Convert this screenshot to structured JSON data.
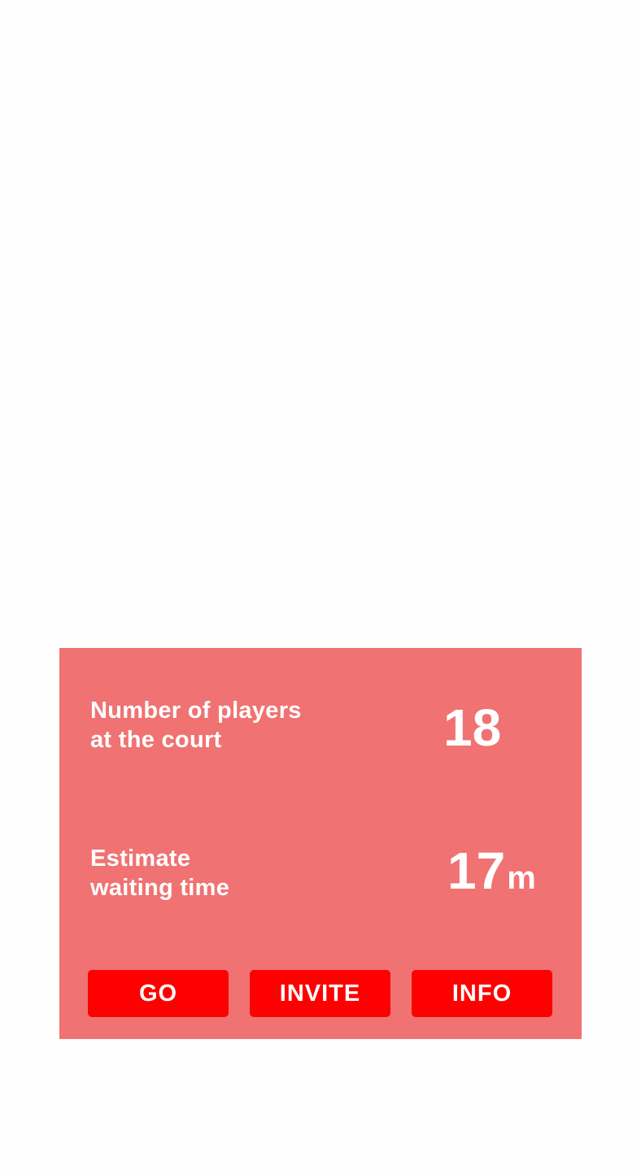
{
  "players": {
    "label_line1": "Number of players",
    "label_line2": "at the court",
    "value": "18"
  },
  "waiting": {
    "label_line1": "Estimate",
    "label_line2": "waiting time",
    "value": "17",
    "unit": "m"
  },
  "actions": {
    "go_label": "GO",
    "invite_label": "INVITE",
    "info_label": "INFO"
  },
  "colors": {
    "panel": "#f07272",
    "button": "#ff0000",
    "text": "#ffffff",
    "background": "#fefefe"
  }
}
